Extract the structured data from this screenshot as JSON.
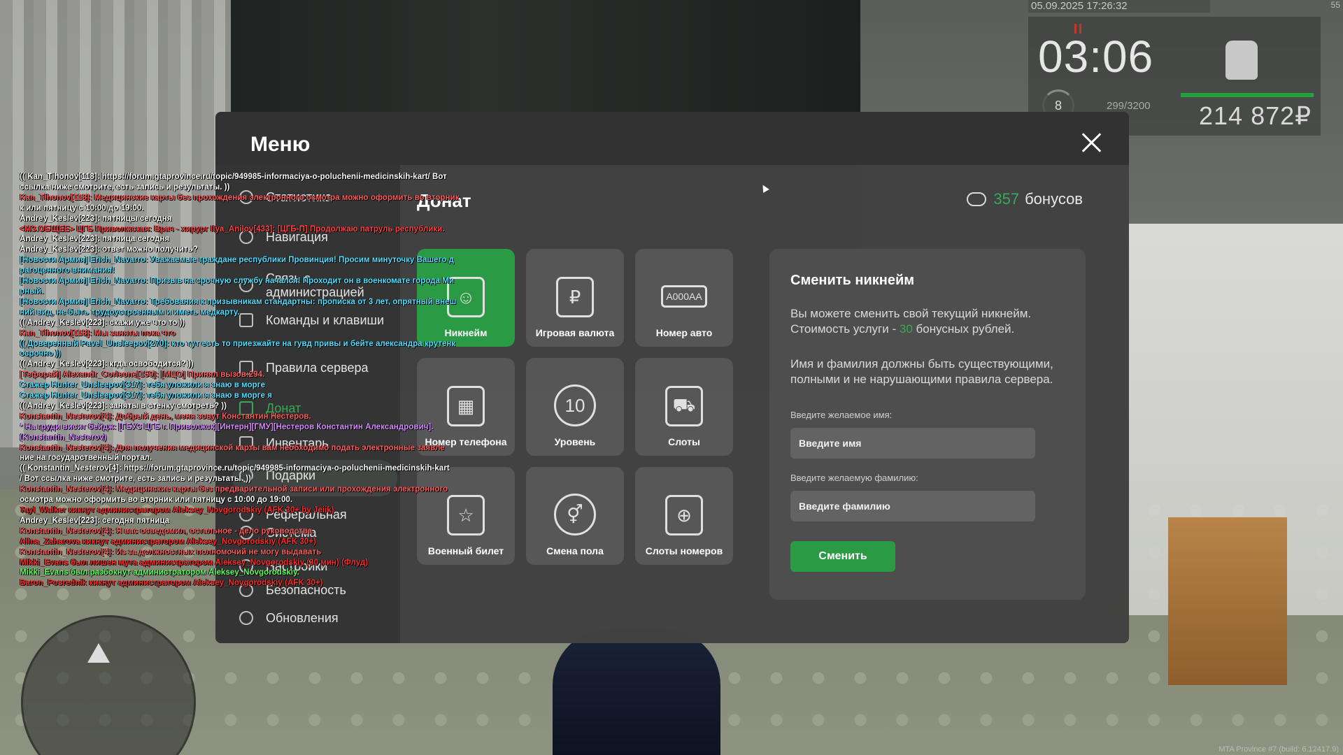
{
  "hud": {
    "datetime": "05.09.2025 17:26:32",
    "corner_number": "55",
    "time": "03:06",
    "level": "8",
    "xp": "299/3200",
    "money": "214 872₽"
  },
  "menu": {
    "title": "Меню",
    "sidebar": [
      {
        "label": "Статистика"
      },
      {
        "label": "Навигация"
      },
      {
        "label": "Связь с администрацией"
      },
      {
        "label": "Команды и клавиши"
      },
      {
        "label": "Правила сервера"
      },
      {
        "label": "Донат"
      },
      {
        "label": "Инвентарь"
      },
      {
        "label": "Подарки"
      },
      {
        "label": "Реферальная"
      },
      {
        "label": "Система"
      },
      {
        "label": "Настройки"
      },
      {
        "label": "Безопасность"
      },
      {
        "label": "Обновления"
      }
    ],
    "active_item": "Донат"
  },
  "donate": {
    "title": "Донат",
    "bonus_count": "357",
    "bonus_label": "бонусов",
    "tiles": [
      {
        "label": "Никнейм",
        "icon": "id-badge-icon"
      },
      {
        "label": "Игровая валюта",
        "icon": "money-icon"
      },
      {
        "label": "Номер авто",
        "icon": "license-plate-icon",
        "plate": "A000AA"
      },
      {
        "label": "Номер телефона",
        "icon": "sim-card-icon"
      },
      {
        "label": "Уровень",
        "icon": "level-icon",
        "value": "10"
      },
      {
        "label": "Слоты",
        "icon": "car-slots-icon"
      },
      {
        "label": "Военный билет",
        "icon": "military-id-icon"
      },
      {
        "label": "Смена пола",
        "icon": "gender-icon"
      },
      {
        "label": "Слоты номеров",
        "icon": "plate-slots-icon"
      }
    ],
    "panel": {
      "title": "Сменить никнейм",
      "text1_a": "Вы можете сменить свой текущий никнейм.",
      "text1_b": "Стоимость услуги - ",
      "price": "30",
      "text1_c": " бонусных рублей.",
      "text2": "Имя и фамилия должны быть существующими, полными и не нарушающими правила сервера.",
      "name_label": "Введите желаемое имя:",
      "name_placeholder": "Введите имя",
      "surname_label": "Введите желаемую фамилию:",
      "surname_placeholder": "Введите фамилию",
      "button": "Сменить"
    }
  },
  "chat": [
    {
      "text": "(( Kan_Tihonov[118]: https://forum.gtaprovince.ru/topic/949985-informaciya-o-poluchenii-medicinskih-kart/ Вот",
      "color": "#ffffff"
    },
    {
      "text": " ссылка ниже смотрите, есть запись и результаты. ))",
      "color": "#ffffff"
    },
    {
      "text": "Kan_Tihonov[118]: Медицинские карты без прохождения электронного осмотра можно оформить во вторник",
      "color": "#ff5c5c"
    },
    {
      "text": "к или пятницу с 10:00 до 19:00.",
      "color": "#ffffff"
    },
    {
      "text": "Andrey_Keslev[223]: пятницы сегодня",
      "color": "#ffffff"
    },
    {
      "text": "<МЗ.ОБЩЕЕ> ЦГБ Приволжская: Врач - хирург Ilya_Anilov[433]: [ЦГБ-П] Продолжаю патруль республики.",
      "color": "#ff4040"
    },
    {
      "text": "Andrey_Keslev[223]: пятница сегодня",
      "color": "#ffffff"
    },
    {
      "text": "Andrey_Keslev[223]: ответ можно получить?",
      "color": "#ffffff"
    },
    {
      "text": "[Новости Армия] Erich_Navarro: Уважаемые граждане республики Провинция! Просим минуточку Вашего д",
      "color": "#4fe0ff"
    },
    {
      "text": "рагоценного внимания!",
      "color": "#4fe0ff"
    },
    {
      "text": "[Новости Армия] Erich_Navarro: Призыв на срочную службу начался! Проходит он в военкомате города Ми",
      "color": "#4fe0ff"
    },
    {
      "text": "рный.",
      "color": "#4fe0ff"
    },
    {
      "text": "[Новости Армия] Erich_Navarro: Требования к призывникам стандартны: прописка от 3 лет, опрятный внеш",
      "color": "#4fe0ff"
    },
    {
      "text": "ний вид, не быть трудоустроенным и иметь медкарту.",
      "color": "#4fe0ff"
    },
    {
      "text": "(( Andrey_Keslev[223]: скажи уже что то ))",
      "color": "#ffffff"
    },
    {
      "text": "Kan_Tihonov[118]: Мы заняты пока что",
      "color": "#ff5c5c"
    },
    {
      "text": "(( Доверенный Pavel_Unsleepov[270]: кто тут есть то приезжайте на гувд привы и бейте александра крутенк",
      "color": "#4fe0ff"
    },
    {
      "text": " осрочно ))",
      "color": "#4fe0ff"
    },
    {
      "text": "(( Andrey_Keslev[223]: кгда освободится? ))",
      "color": "#ffffff"
    },
    {
      "text": "[Тефорай] Alexandr_Corleone[159]: [МЦО] Принял вызов:294.",
      "color": "#ff5c5c"
    },
    {
      "text": "Стажер Hunter_Unsleepov[317]: тебя уложили я знаю в морге",
      "color": "#4fe0ff"
    },
    {
      "text": "Стажер Hunter_Unsleepov[317]: тебя уложили я знаю в морге я",
      "color": "#4fe0ff"
    },
    {
      "text": "(( Andrey_Keslev[223]: заняты в стенку смотреть? ))",
      "color": "#ffffff"
    },
    {
      "text": "Konstantin_Nesterov[4]: Добрый день, меня зовут Константин Нестеров.",
      "color": "#ff5c5c"
    },
    {
      "text": "* На груди висит бейдж: [ГБУЗ ЦГБ г. Приволжск][Интерн][ГМУ][Нестеров Константин Александрович].",
      "color": "#d88bff"
    },
    {
      "text": "(Konstantin_Nesterov)",
      "color": "#d88bff"
    },
    {
      "text": "Konstantin_Nesterov[4]: Для получения медицинской карты вам необходимо подать электронные заявле",
      "color": "#ff5c5c"
    },
    {
      "text": "ние на государственный портал.",
      "color": "#ffffff"
    },
    {
      "text": "(( Konstantin_Nesterov[4]: https://forum.gtaprovince.ru/topic/949985-informaciya-o-poluchenii-medicinskih-kart",
      "color": "#ffffff"
    },
    {
      "text": "/ Вот ссылка ниже смотрите, есть запись и результаты. ))",
      "color": "#ffffff"
    },
    {
      "text": "Konstantin_Nesterov[4]: Медицинские карты без предварительной записи или прохождения электронного",
      "color": "#ff5c5c"
    },
    {
      "text": "осмотра можно оформить во вторник или пятницу с 10:00 до 19:00.",
      "color": "#ffffff"
    },
    {
      "text": "Tayl_Walker кикнут администратором Aleksey_Novgorodskiy (AFK 30+ by Jeiik)",
      "color": "#ff2a2a"
    },
    {
      "text": "Andrey_Keslev[223]: сегодня пятница",
      "color": "#ffffff"
    },
    {
      "text": "Konstantin_Nesterov[4]: Я вас осведомил, остальное - дело руководства.",
      "color": "#ff5c5c"
    },
    {
      "text": "Alina_Zaharova кикнут администратором Aleksey_Novgorodskiy (AFK 30+)",
      "color": "#ff2a2a"
    },
    {
      "text": "Konstantin_Nesterov[4]: Из за должностных полномочий не могу выдавать",
      "color": "#ff5c5c"
    },
    {
      "text": "Mikki_Evans был лишен мута администратором Aleksey_Novgorodskiy (30 мин) (Флуд)",
      "color": "#ff2a2a"
    },
    {
      "text": "Mikki_Evans был разбокнут администратором Aleksey_Novgorodskiy.",
      "color": "#5cff5c"
    },
    {
      "text": "Baron_Posrednik кикнут администратором Aleksey_Novgorodskiy (AFK 30+)",
      "color": "#ff2a2a"
    }
  ],
  "build_info": "MTA Province #7 (build: 6.12417.9)"
}
